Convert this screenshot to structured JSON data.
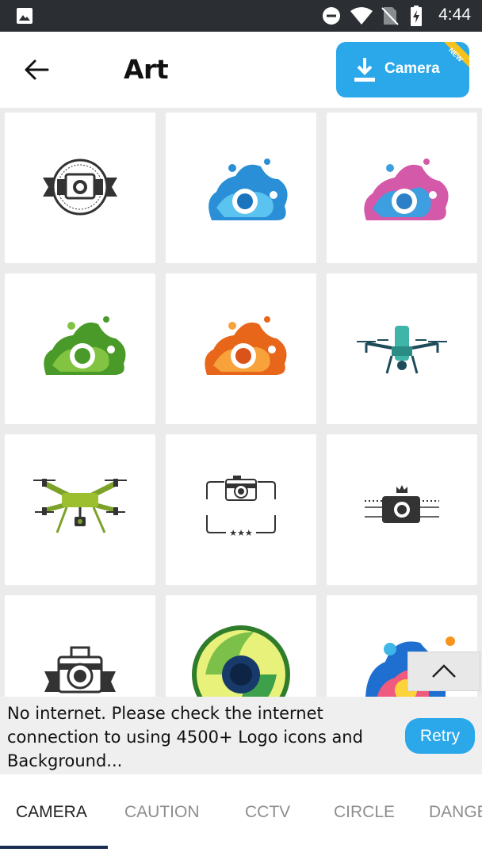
{
  "status_bar": {
    "time": "4:44"
  },
  "header": {
    "title": "Art",
    "download_label": "Camera",
    "badge": "NEW"
  },
  "grid": {
    "items": [
      {
        "icon": "camera-badge-emblem-icon"
      },
      {
        "icon": "blue-splash-camera-icon"
      },
      {
        "icon": "pink-splash-camera-icon"
      },
      {
        "icon": "green-splash-camera-icon"
      },
      {
        "icon": "orange-splash-camera-icon"
      },
      {
        "icon": "teal-drone-icon"
      },
      {
        "icon": "green-drone-icon"
      },
      {
        "icon": "camera-frame-stars-icon"
      },
      {
        "icon": "crowned-camera-icon"
      },
      {
        "icon": "ribbon-camera-icon"
      },
      {
        "icon": "green-lens-circle-icon"
      },
      {
        "icon": "colorful-splash-icon"
      }
    ]
  },
  "banner": {
    "message": "No internet. Please check the internet connection to using 4500+ Logo icons and Background...",
    "retry_label": "Retry"
  },
  "tabs": [
    {
      "label": "CAMERA",
      "active": true
    },
    {
      "label": "CAUTION",
      "active": false
    },
    {
      "label": "CCTV",
      "active": false
    },
    {
      "label": "CIRCLE",
      "active": false
    },
    {
      "label": "DANGER",
      "active": false
    }
  ],
  "colors": {
    "accent": "#2aa8ea",
    "status_bar": "#2b2f33",
    "tab_indicator": "#1c2d55"
  }
}
